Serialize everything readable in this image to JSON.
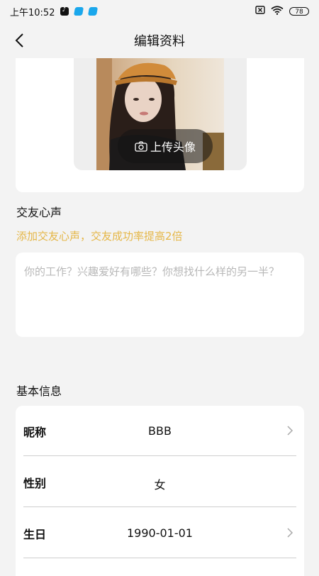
{
  "status_bar": {
    "time": "上午10:52",
    "battery": "78"
  },
  "nav": {
    "title": "编辑资料"
  },
  "avatar": {
    "upload_label": "上传头像"
  },
  "heart_voice": {
    "section_title": "交友心声",
    "tip": "添加交友心声，交友成功率提高2倍",
    "placeholder": "你的工作？兴趣爱好有哪些？你想找什么样的另一半？",
    "value": ""
  },
  "basic_info": {
    "section_title": "基本信息",
    "rows": [
      {
        "label": "昵称",
        "value": "BBB",
        "has_arrow": true
      },
      {
        "label": "性别",
        "value": "女",
        "has_arrow": false
      },
      {
        "label": "生日",
        "value": "1990-01-01",
        "has_arrow": true
      }
    ]
  },
  "colors": {
    "tip": "#e5b748",
    "background": "#f3f3f3",
    "card": "#ffffff"
  }
}
